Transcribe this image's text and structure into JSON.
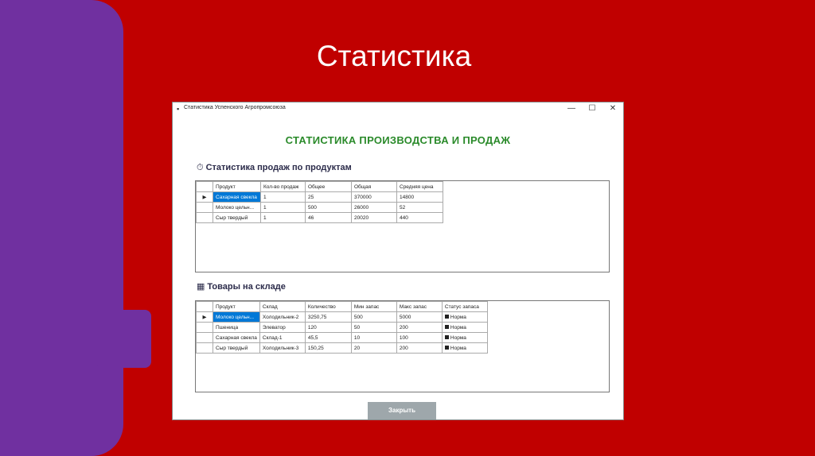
{
  "slide": {
    "title": "Статистика"
  },
  "window": {
    "title": "Статистика Успенского Агропромсоюза",
    "minimize": "—",
    "maximize": "☐",
    "close": "✕"
  },
  "heading": "СТАТИСТИКА ПРОИЗВОДСТВА И ПРОДАЖ",
  "sales": {
    "section_title": "Статистика продаж по продуктам",
    "columns": [
      "Продукт",
      "Кол-во продаж",
      "Общее",
      "Общая",
      "Средняя цена"
    ],
    "rows": [
      [
        "Сахарная свекла",
        "1",
        "25",
        "370000",
        "14800"
      ],
      [
        "Молоко цельн...",
        "1",
        "500",
        "26000",
        "52"
      ],
      [
        "Сыр твердый",
        "1",
        "46",
        "20020",
        "440"
      ]
    ]
  },
  "stock": {
    "section_title": "Товары на складе",
    "columns": [
      "Продукт",
      "Склад",
      "Количество",
      "Мин запас",
      "Макс запас",
      "Статус запаса"
    ],
    "rows": [
      [
        "Молоко цельн...",
        "Холодильник-2",
        "3250,75",
        "500",
        "5000",
        "Норма"
      ],
      [
        "Пшеница",
        "Элеватор",
        "120",
        "50",
        "200",
        "Норма"
      ],
      [
        "Сахарная свекла",
        "Склад-1",
        "45,5",
        "10",
        "100",
        "Норма"
      ],
      [
        "Сыр твердый",
        "Холодильник-3",
        "150,25",
        "20",
        "200",
        "Норма"
      ]
    ]
  },
  "close_button": "Закрыть",
  "icons": {
    "row_pointer": "▶",
    "sales_icon": "⏱",
    "stock_icon": "▦"
  }
}
